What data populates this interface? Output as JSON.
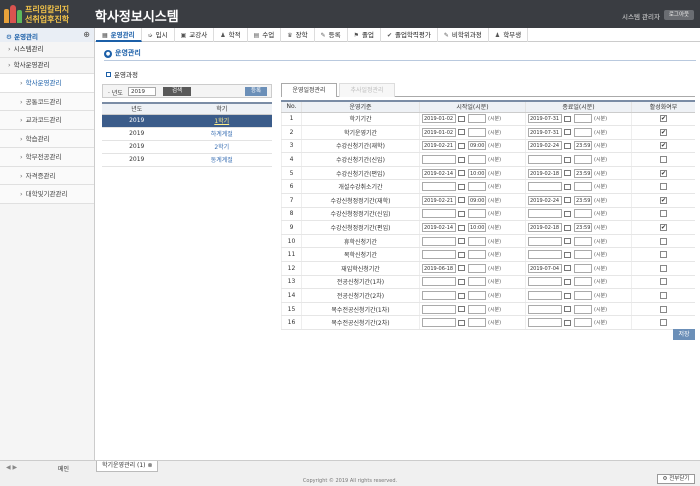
{
  "brand": {
    "line1": "프리임칼리지",
    "line2": "선취업후진학"
  },
  "app_title": "학사정보시스템",
  "user": {
    "info": "시스템 관리자",
    "logout": "로그아웃"
  },
  "sidebar": {
    "header": "운영관리",
    "items": [
      {
        "label": "시스템관리"
      },
      {
        "label": "학사운영관리"
      }
    ],
    "subitems": [
      {
        "label": "학사운영관리"
      },
      {
        "label": "공통코드관리"
      },
      {
        "label": "교과코드관리"
      },
      {
        "label": "학습관리"
      },
      {
        "label": "학부전공관리"
      },
      {
        "label": "자격증관리"
      },
      {
        "label": "대학및기관관리"
      }
    ]
  },
  "menu": [
    "운영관리",
    "입시",
    "교강사",
    "학적",
    "수업",
    "장학",
    "등록",
    "졸업",
    "졸업학력평가",
    "비학위과정",
    "학부생"
  ],
  "page": {
    "title": "운영관리",
    "section": "운영과정"
  },
  "filter": {
    "label": "년도",
    "year": "2019",
    "search": "검색",
    "register": "등록"
  },
  "left_table": {
    "headers": [
      "년도",
      "학기"
    ],
    "rows": [
      {
        "year": "2019",
        "term": "1학기"
      },
      {
        "year": "2019",
        "term": "하계계절"
      },
      {
        "year": "2019",
        "term": "2학기"
      },
      {
        "year": "2019",
        "term": "동계계절"
      }
    ]
  },
  "right_tabs": [
    "운영일정관리",
    "추사일정관리"
  ],
  "right_table": {
    "headers": [
      "No.",
      "운영기준",
      "시작일(시분)",
      "종료일(시분)",
      "활성화여부"
    ],
    "hour_label": "(시분)",
    "rows": [
      {
        "no": "1",
        "name": "학기기간",
        "start": "2019-01-02",
        "stime": "",
        "end": "2019-07-31",
        "etime": "",
        "active": true
      },
      {
        "no": "2",
        "name": "학기운영기간",
        "start": "2019-01-02",
        "stime": "",
        "end": "2019-07-31",
        "etime": "",
        "active": true
      },
      {
        "no": "3",
        "name": "수강신청기간(재학)",
        "start": "2019-02-21",
        "stime": "09:00",
        "end": "2019-02-24",
        "etime": "23:59",
        "active": true
      },
      {
        "no": "4",
        "name": "수강신청기간(신입)",
        "start": "",
        "stime": "",
        "end": "",
        "etime": "",
        "active": false
      },
      {
        "no": "5",
        "name": "수강신청기간(편입)",
        "start": "2019-02-14",
        "stime": "10:00",
        "end": "2019-02-18",
        "etime": "23:59",
        "active": true
      },
      {
        "no": "6",
        "name": "개설수강취소기간",
        "start": "",
        "stime": "",
        "end": "",
        "etime": "",
        "active": false
      },
      {
        "no": "7",
        "name": "수강신청정정기간(재학)",
        "start": "2019-02-21",
        "stime": "09:00",
        "end": "2019-02-24",
        "etime": "23:59",
        "active": true
      },
      {
        "no": "8",
        "name": "수강신청정정기간(신입)",
        "start": "",
        "stime": "",
        "end": "",
        "etime": "",
        "active": false
      },
      {
        "no": "9",
        "name": "수강신청정정기간(편입)",
        "start": "2019-02-14",
        "stime": "10:00",
        "end": "2019-02-18",
        "etime": "23:59",
        "active": true
      },
      {
        "no": "10",
        "name": "휴학신청기간",
        "start": "",
        "stime": "",
        "end": "",
        "etime": "",
        "active": false
      },
      {
        "no": "11",
        "name": "복학신청기간",
        "start": "",
        "stime": "",
        "end": "",
        "etime": "",
        "active": false
      },
      {
        "no": "12",
        "name": "재입학신청기간",
        "start": "2019-06-18",
        "stime": "",
        "end": "2019-07-04",
        "etime": "",
        "active": false
      },
      {
        "no": "13",
        "name": "전공신청기간(1차)",
        "start": "",
        "stime": "",
        "end": "",
        "etime": "",
        "active": false
      },
      {
        "no": "14",
        "name": "전공신청기간(2차)",
        "start": "",
        "stime": "",
        "end": "",
        "etime": "",
        "active": false
      },
      {
        "no": "15",
        "name": "복수전공신청기간(1차)",
        "start": "",
        "stime": "",
        "end": "",
        "etime": "",
        "active": false
      },
      {
        "no": "16",
        "name": "복수전공신청기간(2차)",
        "start": "",
        "stime": "",
        "end": "",
        "etime": "",
        "active": false
      }
    ]
  },
  "save": "저장",
  "bottom": {
    "home": "메인",
    "tab": "학기운영관리 (1)",
    "copyright": "Copyright © 2019 All rights reserved.",
    "close_all": "전부닫기"
  }
}
